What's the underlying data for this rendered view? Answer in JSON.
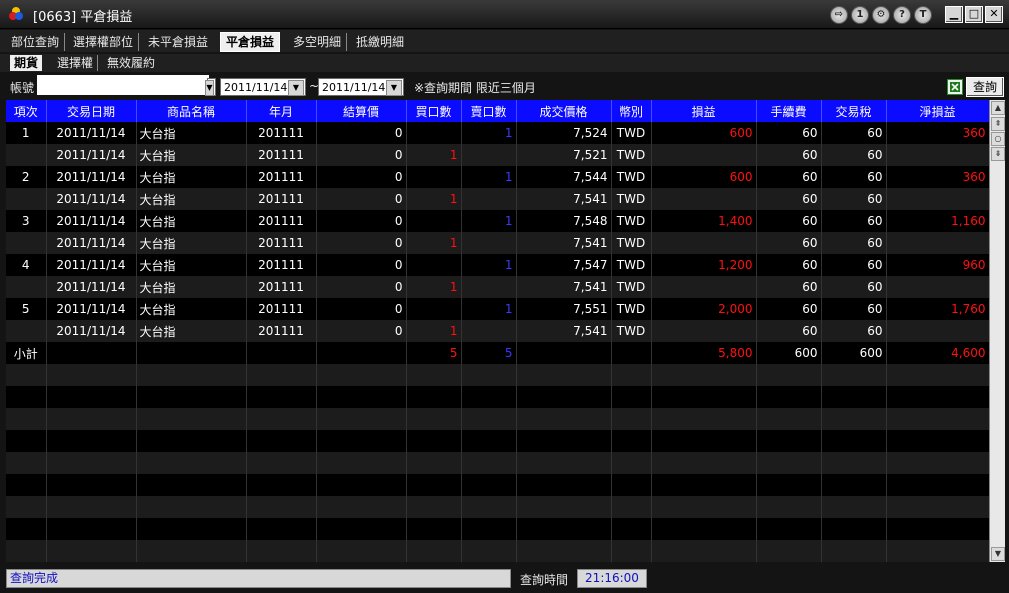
{
  "window": {
    "title": "[0663] 平倉損益",
    "toolbar_icons": [
      "arrow-icon",
      "info-icon",
      "link-icon",
      "help-icon",
      "text-icon"
    ],
    "toolbar_glyphs": [
      "⇨",
      "1",
      "⚙",
      "?",
      "T"
    ],
    "controls": [
      "▁",
      "□",
      "✕"
    ]
  },
  "tabs": [
    {
      "label": "部位查詢",
      "active": false
    },
    {
      "label": "選擇權部位",
      "active": false
    },
    {
      "label": "未平倉損益",
      "active": false
    },
    {
      "label": "平倉損益",
      "active": true
    },
    {
      "label": "多空明細",
      "active": false
    },
    {
      "label": "抵繳明細",
      "active": false
    }
  ],
  "subtabs": [
    {
      "label": "期貨",
      "active": true
    },
    {
      "label": "選擇權",
      "active": false
    },
    {
      "label": "無效履約",
      "active": false
    }
  ],
  "filter": {
    "account_label": "帳號",
    "account_value": "",
    "date_from": "2011/11/14",
    "tilde": "~",
    "date_to": "2011/11/14",
    "note": "※查詢期間 限近三個月",
    "query_button": "查詢"
  },
  "table": {
    "columns": [
      "項次",
      "交易日期",
      "商品名稱",
      "年月",
      "結算價",
      "買口數",
      "賣口數",
      "成交價格",
      "幣別",
      "損益",
      "手續費",
      "交易稅",
      "淨損益"
    ],
    "rows": [
      [
        "1",
        "2011/11/14",
        "大台指",
        "201111",
        "0",
        "",
        "1",
        "7,524",
        "TWD",
        "600",
        "60",
        "60",
        "360"
      ],
      [
        "",
        "2011/11/14",
        "大台指",
        "201111",
        "0",
        "1",
        "",
        "7,521",
        "TWD",
        "",
        "60",
        "60",
        ""
      ],
      [
        "2",
        "2011/11/14",
        "大台指",
        "201111",
        "0",
        "",
        "1",
        "7,544",
        "TWD",
        "600",
        "60",
        "60",
        "360"
      ],
      [
        "",
        "2011/11/14",
        "大台指",
        "201111",
        "0",
        "1",
        "",
        "7,541",
        "TWD",
        "",
        "60",
        "60",
        ""
      ],
      [
        "3",
        "2011/11/14",
        "大台指",
        "201111",
        "0",
        "",
        "1",
        "7,548",
        "TWD",
        "1,400",
        "60",
        "60",
        "1,160"
      ],
      [
        "",
        "2011/11/14",
        "大台指",
        "201111",
        "0",
        "1",
        "",
        "7,541",
        "TWD",
        "",
        "60",
        "60",
        ""
      ],
      [
        "4",
        "2011/11/14",
        "大台指",
        "201111",
        "0",
        "",
        "1",
        "7,547",
        "TWD",
        "1,200",
        "60",
        "60",
        "960"
      ],
      [
        "",
        "2011/11/14",
        "大台指",
        "201111",
        "0",
        "1",
        "",
        "7,541",
        "TWD",
        "",
        "60",
        "60",
        ""
      ],
      [
        "5",
        "2011/11/14",
        "大台指",
        "201111",
        "0",
        "",
        "1",
        "7,551",
        "TWD",
        "2,000",
        "60",
        "60",
        "1,760"
      ],
      [
        "",
        "2011/11/14",
        "大台指",
        "201111",
        "0",
        "1",
        "",
        "7,541",
        "TWD",
        "",
        "60",
        "60",
        ""
      ]
    ],
    "subtotal": [
      "小計",
      "",
      "",
      "",
      "",
      "5",
      "5",
      "",
      "",
      "5,800",
      "600",
      "600",
      "4,600"
    ]
  },
  "status": {
    "message": "查詢完成",
    "time_label": "查詢時間",
    "time_value": "21:16:00"
  },
  "colors": {
    "header_bg": "#0b0bff",
    "profit": "#ff1010",
    "sell_qty": "#3a3aff"
  }
}
